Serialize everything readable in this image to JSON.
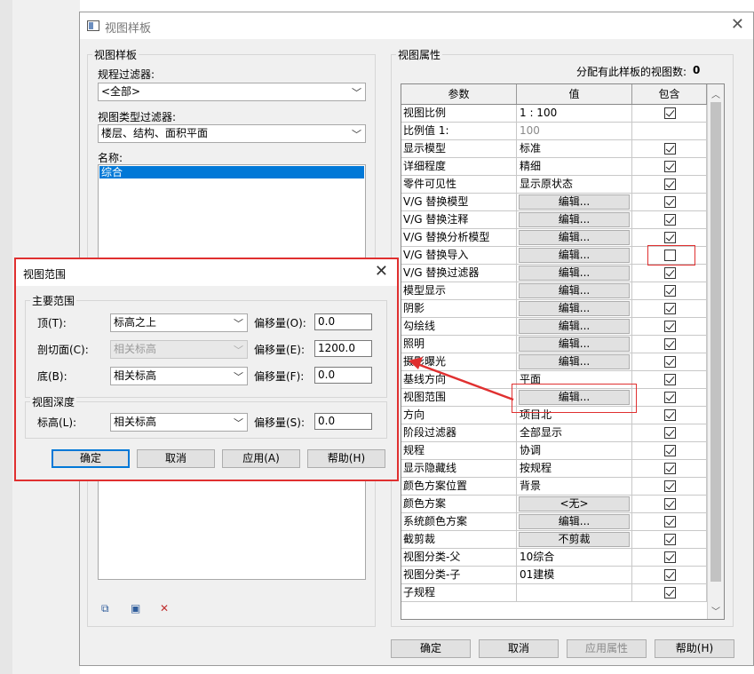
{
  "main_window": {
    "title": "视图样板",
    "close_glyph": "✕",
    "left_group_title": "视图样板",
    "discipline_filter_label": "规程过滤器:",
    "discipline_filter_value": "<全部>",
    "view_type_filter_label": "视图类型过滤器:",
    "view_type_filter_value": "楼层、结构、面积平面",
    "name_label": "名称:",
    "names": [
      "综合"
    ],
    "right_group_title": "视图属性",
    "assigned_count_label": "分配有此样板的视图数:",
    "assigned_count": "0",
    "table_headers": {
      "param": "参数",
      "value": "值",
      "include": "包含"
    },
    "rows": [
      {
        "param": "视图比例",
        "value": "1 : 100",
        "type": "text",
        "include": true
      },
      {
        "param": "比例值 1:",
        "value": "100",
        "type": "gray",
        "include": null
      },
      {
        "param": "显示模型",
        "value": "标准",
        "type": "text",
        "include": true
      },
      {
        "param": "详细程度",
        "value": "精细",
        "type": "text",
        "include": true
      },
      {
        "param": "零件可见性",
        "value": "显示原状态",
        "type": "text",
        "include": true
      },
      {
        "param": "V/G 替换模型",
        "value": "编辑...",
        "type": "button",
        "include": true
      },
      {
        "param": "V/G 替换注释",
        "value": "编辑...",
        "type": "button",
        "include": true
      },
      {
        "param": "V/G 替换分析模型",
        "value": "编辑...",
        "type": "button",
        "include": true
      },
      {
        "param": "V/G 替换导入",
        "value": "编辑...",
        "type": "button",
        "include": false
      },
      {
        "param": "V/G 替换过滤器",
        "value": "编辑...",
        "type": "button",
        "include": true
      },
      {
        "param": "模型显示",
        "value": "编辑...",
        "type": "button",
        "include": true
      },
      {
        "param": "阴影",
        "value": "编辑...",
        "type": "button",
        "include": true
      },
      {
        "param": "勾绘线",
        "value": "编辑...",
        "type": "button",
        "include": true
      },
      {
        "param": "照明",
        "value": "编辑...",
        "type": "button",
        "include": true
      },
      {
        "param": "摄影曝光",
        "value": "编辑...",
        "type": "button",
        "include": true
      },
      {
        "param": "基线方向",
        "value": "平面",
        "type": "text",
        "include": true
      },
      {
        "param": "视图范围",
        "value": "编辑...",
        "type": "button",
        "include": true
      },
      {
        "param": "方向",
        "value": "项目北",
        "type": "text",
        "include": true
      },
      {
        "param": "阶段过滤器",
        "value": "全部显示",
        "type": "text",
        "include": true
      },
      {
        "param": "规程",
        "value": "协调",
        "type": "text",
        "include": true
      },
      {
        "param": "显示隐藏线",
        "value": "按规程",
        "type": "text",
        "include": true
      },
      {
        "param": "颜色方案位置",
        "value": "背景",
        "type": "text",
        "include": true
      },
      {
        "param": "颜色方案",
        "value": "<无>",
        "type": "button",
        "include": true
      },
      {
        "param": "系统颜色方案",
        "value": "编辑...",
        "type": "button",
        "include": true
      },
      {
        "param": "截剪裁",
        "value": "不剪裁",
        "type": "button",
        "include": true
      },
      {
        "param": "视图分类-父",
        "value": "10综合",
        "type": "text",
        "include": true
      },
      {
        "param": "视图分类-子",
        "value": "01建模",
        "type": "text",
        "include": true
      },
      {
        "param": "子规程",
        "value": "",
        "type": "text",
        "include": true
      }
    ],
    "ok_label": "确定",
    "cancel_label": "取消",
    "apply_props_label": "应用属性",
    "help_label": "帮助(H)"
  },
  "dialog": {
    "title": "视图范围",
    "close_glyph": "✕",
    "primary_range_title": "主要范围",
    "top_label": "顶(T):",
    "top_value": "标高之上",
    "top_offset_label": "偏移量(O):",
    "top_offset": "0.0",
    "cut_label": "剖切面(C):",
    "cut_value": "相关标高",
    "cut_offset_label": "偏移量(E):",
    "cut_offset": "1200.0",
    "bottom_label": "底(B):",
    "bottom_value": "相关标高",
    "bottom_offset_label": "偏移量(F):",
    "bottom_offset": "0.0",
    "depth_title": "视图深度",
    "level_label": "标高(L):",
    "level_value": "相关标高",
    "level_offset_label": "偏移量(S):",
    "level_offset": "0.0",
    "ok_label": "确定",
    "cancel_label": "取消",
    "apply_label": "应用(A)",
    "help_label": "帮助(H)"
  },
  "colors": {
    "highlight_red": "#e03030",
    "selection_blue": "#0078d7"
  }
}
